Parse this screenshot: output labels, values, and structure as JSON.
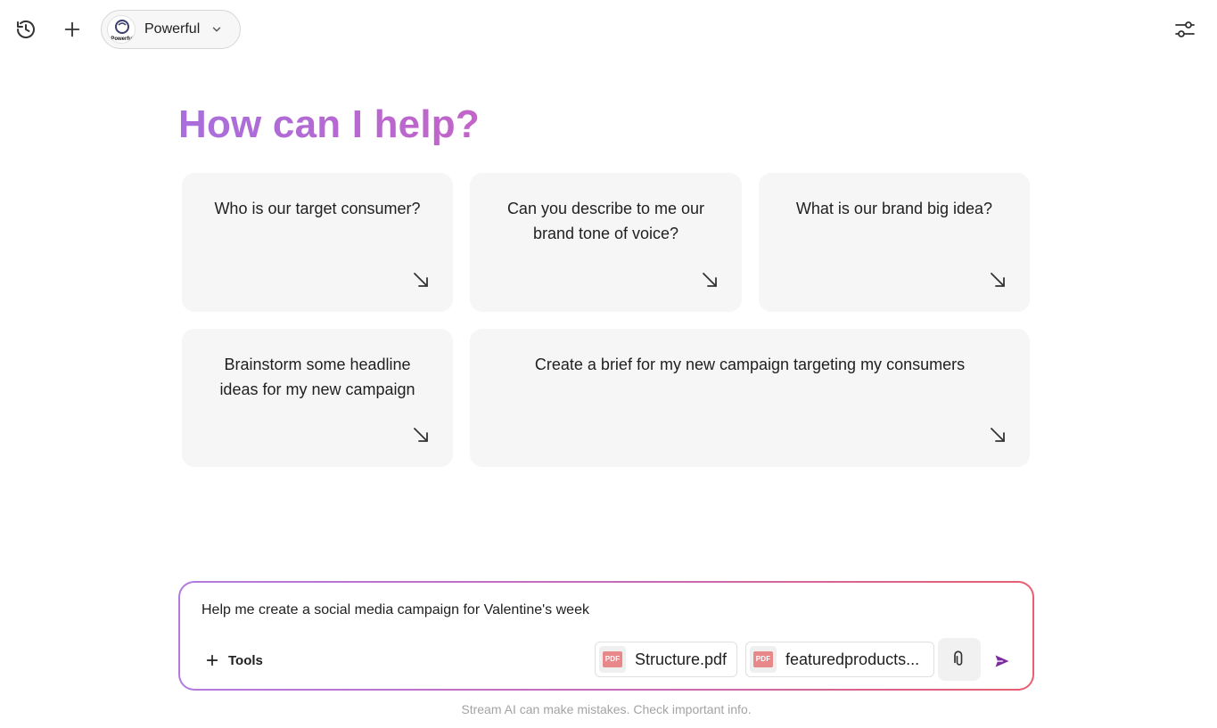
{
  "topbar": {
    "history_icon": "history-icon",
    "new_chat_icon": "plus-icon",
    "settings_icon": "sliders-icon",
    "model": {
      "logo_text": "Powerful",
      "label": "Powerful",
      "chevron_icon": "chevron-down-icon"
    }
  },
  "main": {
    "heading": "How can I help?",
    "suggestions": [
      {
        "text": "Who is our target consumer?"
      },
      {
        "text": "Can you describe to me our brand tone of voice?"
      },
      {
        "text": "What is our brand big idea?"
      },
      {
        "text": "Brainstorm some headline ideas for my new campaign"
      },
      {
        "text": "Create a brief for my new campaign targeting my consumers"
      }
    ],
    "suggestion_arrow_icon": "arrow-down-right-icon"
  },
  "composer": {
    "value": "Help me create a social media campaign for Valentine's week",
    "tools_label": "Tools",
    "attachments": [
      {
        "type": "PDF",
        "name": "Structure.pdf"
      },
      {
        "type": "PDF",
        "name": "featuredproducts..."
      }
    ],
    "attach_icon": "paperclip-icon",
    "send_icon": "send-icon"
  },
  "footer": {
    "disclaimer": "Stream AI can make mistakes. Check important info."
  },
  "colors": {
    "heading_gradient_start": "#a86fdc",
    "heading_gradient_end": "#c264c8",
    "composer_border_start": "#b37ae0",
    "composer_border_end": "#e8606f",
    "send_icon": "#7b2d9e",
    "card_bg": "#f6f6f6"
  }
}
